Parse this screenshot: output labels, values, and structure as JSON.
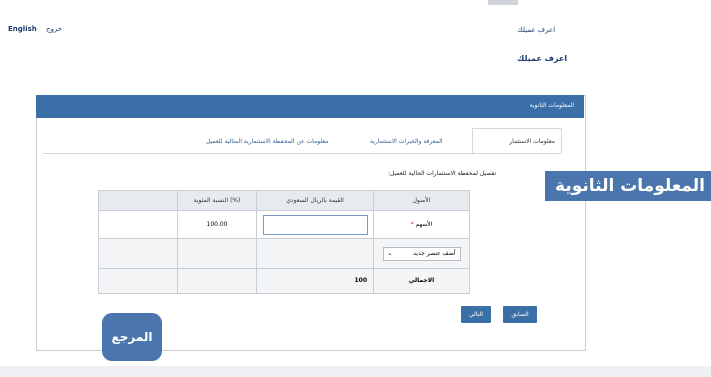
{
  "top": {
    "english_link": "English",
    "logout_link": "خروج",
    "know_customer_small": "اعرف عميلك",
    "know_customer_title": "اعرف عميلك"
  },
  "panel": {
    "header": "المعلومات الثانوية"
  },
  "tabs": [
    {
      "label": "معلومات الاستثمار",
      "active": true
    },
    {
      "label": "المعرفة والخبرات الاستثمارية",
      "active": false
    },
    {
      "label": "معلومات عن المحفظة الاستثمارية المثالية للعميل",
      "active": false
    }
  ],
  "section_label": "تفصيل لمحفظة الاستثمارات الحالية للعميل:",
  "table": {
    "headers": [
      "الأصول",
      "القيمة بالريال السعودي",
      "النسبة المئوية (%)"
    ],
    "row_stocks": {
      "label": "الأسهم",
      "required_mark": "*",
      "value": "",
      "percent": "100.00"
    },
    "add_select": {
      "label": "أضف عنصر جديد",
      "chevron": "chevron-down-icon"
    },
    "total_row": {
      "label": "الاجمالي",
      "value": "100"
    }
  },
  "buttons": {
    "previous": "السابق",
    "next": "التالي"
  },
  "banner": "المعلومات الثانوية",
  "badge_text": "المرجع",
  "colors": {
    "accent": "#3a6fa7",
    "banner": "#4a76ad"
  }
}
